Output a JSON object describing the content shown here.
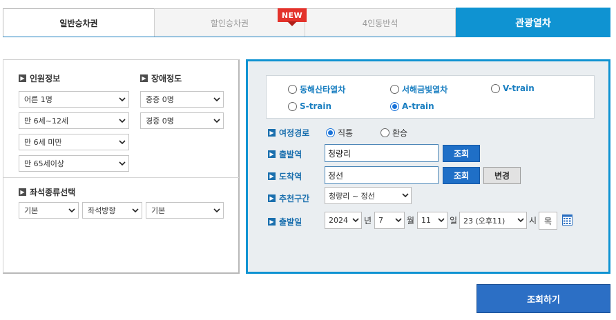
{
  "tabs": [
    {
      "label": "일반승차권"
    },
    {
      "label": "할인승차권"
    },
    {
      "label": "4인동반석"
    },
    {
      "label": "관광열차"
    }
  ],
  "new_badge": "NEW",
  "passengers": {
    "title": "인원정보",
    "adult": "어른 1명",
    "child": "만 6세~12세",
    "infant": "만 6세 미만",
    "senior": "만 65세이상"
  },
  "disability": {
    "title": "장애정도",
    "severe": "중증 0명",
    "mild": "경증 0명"
  },
  "seat": {
    "title": "좌석종류선택",
    "type": "기본",
    "direction": "좌석방향",
    "position": "기본"
  },
  "trains": [
    {
      "label": "동해산타열차",
      "checked": false
    },
    {
      "label": "서해금빛열차",
      "checked": false
    },
    {
      "label": "V-train",
      "checked": false
    },
    {
      "label": "S-train",
      "checked": false
    },
    {
      "label": "A-train",
      "checked": true
    }
  ],
  "route": {
    "label": "여정경로",
    "direct": "직통",
    "transfer": "환승"
  },
  "departure": {
    "label": "출발역",
    "value": "청량리",
    "lookup": "조회"
  },
  "arrival": {
    "label": "도착역",
    "value": "정선",
    "lookup": "조회",
    "change": "변경"
  },
  "section": {
    "label": "추천구간",
    "value": "청량리 ~ 정선"
  },
  "date": {
    "label": "출발일",
    "year": "2024",
    "year_unit": "년",
    "month": "7",
    "month_unit": "월",
    "day": "11",
    "day_unit": "일",
    "hour": "23 (오후11)",
    "hour_unit": "시",
    "weekday": "목"
  },
  "search_button": "조회하기",
  "colors": {
    "accent": "#0f93d2",
    "button_blue": "#1f6fc7",
    "label_blue": "#1a6fae",
    "new_red": "#e3322b"
  }
}
